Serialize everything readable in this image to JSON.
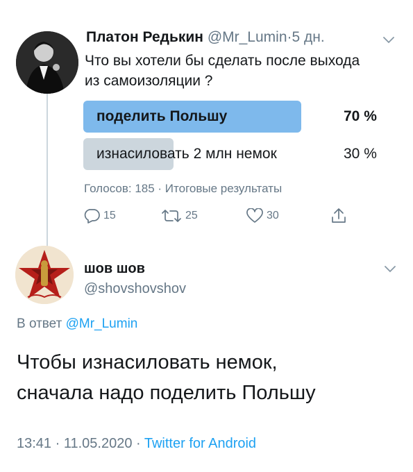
{
  "tweet1": {
    "display_name": "Платон Редькин",
    "handle": "@Mr_Lumin",
    "separator": "·",
    "time_ago": "5 дн.",
    "text": "Что вы хотели бы сделать после выхода из самоизоляции ?",
    "poll": {
      "options": [
        {
          "label": "поделить Польшу",
          "percent": "70 %",
          "value": 70,
          "winner": true
        },
        {
          "label": "изнасиловать 2 млн немок",
          "percent": "30 %",
          "value": 30,
          "winner": false
        }
      ],
      "summary": "Голосов: 185 · Итоговые результаты"
    },
    "actions": {
      "reply_count": "15",
      "retweet_count": "25",
      "like_count": "30"
    }
  },
  "tweet2": {
    "display_name": "шов шов",
    "handle": "@shovshovshov",
    "reply_prefix": "В ответ",
    "reply_mention": "@Mr_Lumin",
    "text_line1": "Чтобы изнасиловать немок,",
    "text_line2": "сначала надо поделить Польшу",
    "timestamp": "13:41 · 11.05.2020 ·",
    "source": "Twitter for Android"
  },
  "colors": {
    "accent": "#1da1f2",
    "poll_winner": "#7eb9ec",
    "poll_other": "#ccd6dd",
    "secondary_text": "#657786"
  },
  "icons": [
    "reply-icon",
    "retweet-icon",
    "like-icon",
    "share-icon",
    "chevron-down-icon"
  ]
}
